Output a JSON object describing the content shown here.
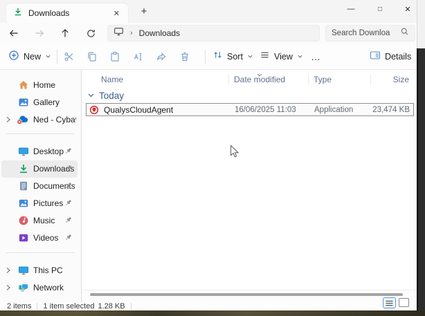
{
  "titlebar": {
    "tab_label": "Downloads",
    "tab_close_glyph": "✕",
    "new_tab_glyph": "+",
    "minimize_glyph": "—",
    "maximize_glyph": "□",
    "close_glyph": "✕"
  },
  "navbar": {
    "breadcrumb_separator": "›",
    "breadcrumb_item": "Downloads",
    "search_text": "Search Downloa"
  },
  "toolbar": {
    "new_label": "New",
    "sort_label": "Sort",
    "view_label": "View",
    "more_label": "…",
    "details_label": "Details"
  },
  "columns": {
    "name": "Name",
    "date_modified": "Date modified",
    "type": "Type",
    "size": "Size"
  },
  "group_label": "Today",
  "files": [
    {
      "name": "QualysCloudAgent",
      "date_modified": "16/06/2025 11:03",
      "type": "Application",
      "size": "23,474 KB",
      "selected": true
    }
  ],
  "sidebar": {
    "items": [
      {
        "label": "Home"
      },
      {
        "label": "Gallery"
      },
      {
        "label": "Ned - Cybaverse"
      },
      {
        "label": "Desktop",
        "pinned": true
      },
      {
        "label": "Downloads",
        "pinned": true,
        "selected": true
      },
      {
        "label": "Documents",
        "pinned": true
      },
      {
        "label": "Pictures",
        "pinned": true
      },
      {
        "label": "Music",
        "pinned": true
      },
      {
        "label": "Videos",
        "pinned": true
      },
      {
        "label": "This PC"
      },
      {
        "label": "Network"
      }
    ]
  },
  "statusbar": {
    "items_count": "2 items",
    "selected_count": "1 item selected",
    "selected_size": "1.28 KB"
  },
  "colors": {
    "accent": "#0078d4",
    "downloads_green": "#129a5f",
    "qualys_red": "#d1342f",
    "toolbar_icon_blue": "#7fa3cc",
    "selection_border": "#8f8f8f"
  }
}
